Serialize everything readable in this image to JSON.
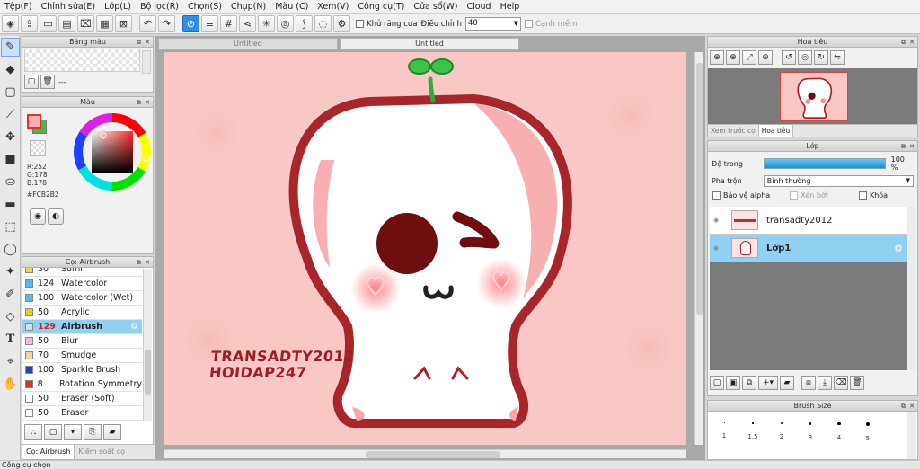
{
  "menu": [
    "Tệp(F)",
    "Chỉnh sửa(E)",
    "Lớp(L)",
    "Bộ lọc(R)",
    "Chọn(S)",
    "Chụp(N)",
    "Màu (C)",
    "Xem(V)",
    "Công cụ(T)",
    "Cửa sổ(W)",
    "Cloud",
    "Help"
  ],
  "toolbar": {
    "antialias_label": "Khử răng cưa",
    "adjust_label": "Điều chỉnh",
    "adjust_value": "40",
    "soft_edge_label": "Cạnh mềm"
  },
  "swatch_panel": {
    "title": "Bảng màu",
    "count_label": "---"
  },
  "color_panel": {
    "title": "Màu",
    "r": "R:252",
    "g": "G:178",
    "b": "B:178",
    "hex": "#FCB2B2",
    "main_color": "#FCB2B2",
    "sub_color": "#48B848"
  },
  "brush_panel": {
    "title": "Cọ: Airbrush",
    "items": [
      {
        "size": "30",
        "name": "Sumi",
        "color": "#e8d84a"
      },
      {
        "size": "124",
        "name": "Watercolor",
        "color": "#5ab8e8"
      },
      {
        "size": "100",
        "name": "Watercolor (Wet)",
        "color": "#5ab8e8"
      },
      {
        "size": "50",
        "name": "Acrylic",
        "color": "#e8d020"
      },
      {
        "size": "129",
        "name": "Airbrush",
        "color": "#c8e0f0"
      },
      {
        "size": "50",
        "name": "Blur",
        "color": "#f0b8e0"
      },
      {
        "size": "70",
        "name": "Smudge",
        "color": "#f0d8a0"
      },
      {
        "size": "100",
        "name": "Sparkle Brush",
        "color": "#2040d0"
      },
      {
        "size": "8",
        "name": "Rotation Symmetry",
        "color": "#e03030"
      },
      {
        "size": "50",
        "name": "Eraser (Soft)",
        "color": "#ffffff"
      },
      {
        "size": "50",
        "name": "Eraser",
        "color": "#ffffff"
      }
    ],
    "selected_index": 4
  },
  "bottom_tabs": [
    "Cọ: Airbrush",
    "Kiểm soát cọ"
  ],
  "doc_tabs": [
    "Untitled",
    "Untitled"
  ],
  "artwork": {
    "watermark_line1": "TRANSADTY2012",
    "watermark_line2": "HOIDAP247"
  },
  "navigator": {
    "title": "Hoa tiêu",
    "tabs": [
      "Xem trước cọ",
      "Hoa tiêu"
    ]
  },
  "layer_panel": {
    "title": "Lớp",
    "opacity_label": "Độ trong",
    "opacity_value": "100 %",
    "opacity_fraction": 1.0,
    "blend_label": "Pha trộn",
    "blend_value": "Bình thường",
    "protect_alpha": "Bảo vệ alpha",
    "clipping": "Xén bớt",
    "lock": "Khóa",
    "layers": [
      {
        "name": "transadty2012",
        "selected": false
      },
      {
        "name": "Lớp1",
        "selected": true
      }
    ]
  },
  "brush_size_panel": {
    "title": "Brush Size",
    "sizes": [
      "1",
      "1.5",
      "2",
      "3",
      "4",
      "5"
    ]
  },
  "status": "Công cụ chọn"
}
